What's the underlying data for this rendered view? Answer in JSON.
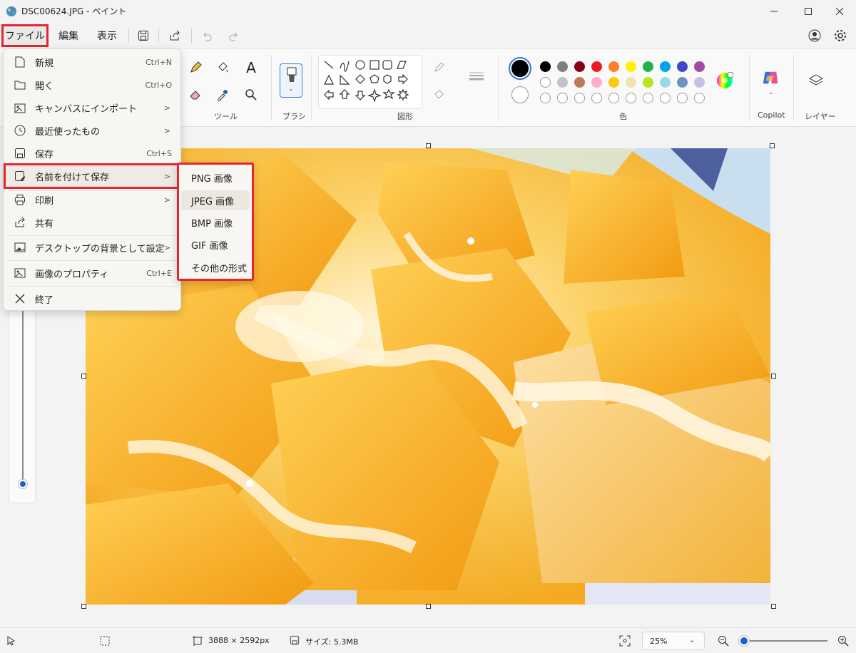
{
  "window": {
    "title": "DSC00624.JPG - ペイント"
  },
  "menubar": {
    "file": "ファイル",
    "edit": "編集",
    "view": "表示"
  },
  "ribbon": {
    "groups": {
      "tools": "ツール",
      "brush": "ブラシ",
      "shapes": "図形",
      "color": "色",
      "copilot": "Copilot",
      "layers": "レイヤー"
    },
    "text_tool_glyph": "A",
    "colors_row1": [
      "#000000",
      "#7f7f7f",
      "#880015",
      "#ed1c24",
      "#ff7f27",
      "#fff200",
      "#22b14c",
      "#00a2e8",
      "#3f48cc",
      "#a349a4"
    ],
    "colors_row2": [
      "#ffffff",
      "#c3c3c3",
      "#b97a57",
      "#ffaec9",
      "#ffc90e",
      "#efe4b0",
      "#b5e61d",
      "#99d9ea",
      "#7092be",
      "#c8bfe7"
    ],
    "primary_color": "#000000",
    "secondary_color": "#ffffff"
  },
  "file_menu": {
    "items": [
      {
        "label": "新規",
        "shortcut": "Ctrl+N",
        "icon": "new-file-icon"
      },
      {
        "label": "開く",
        "shortcut": "Ctrl+O",
        "icon": "folder-icon"
      },
      {
        "label": "キャンバスにインポート",
        "submenu": ">",
        "icon": "import-icon"
      },
      {
        "label": "最近使ったもの",
        "submenu": ">",
        "icon": "clock-icon"
      },
      {
        "label": "保存",
        "shortcut": "Ctrl+S",
        "icon": "save-icon"
      },
      {
        "label": "名前を付けて保存",
        "submenu": ">",
        "icon": "save-as-icon"
      },
      {
        "label": "印刷",
        "submenu": ">",
        "icon": "printer-icon"
      },
      {
        "label": "共有",
        "icon": "share-icon"
      },
      {
        "label": "デスクトップの背景として設定",
        "submenu": ">",
        "icon": "desktop-background-icon"
      },
      {
        "label": "画像のプロパティ",
        "shortcut": "Ctrl+E",
        "icon": "image-properties-icon"
      },
      {
        "label": "終了",
        "icon": "close-icon"
      }
    ]
  },
  "save_as_submenu": {
    "items": [
      "PNG 画像",
      "JPEG 画像",
      "BMP 画像",
      "GIF 画像",
      "その他の形式"
    ]
  },
  "status": {
    "dimensions": "3888 × 2592px",
    "size": "サイズ: 5.3MB",
    "zoom": "25%",
    "zoom_arrow": "⌄"
  }
}
